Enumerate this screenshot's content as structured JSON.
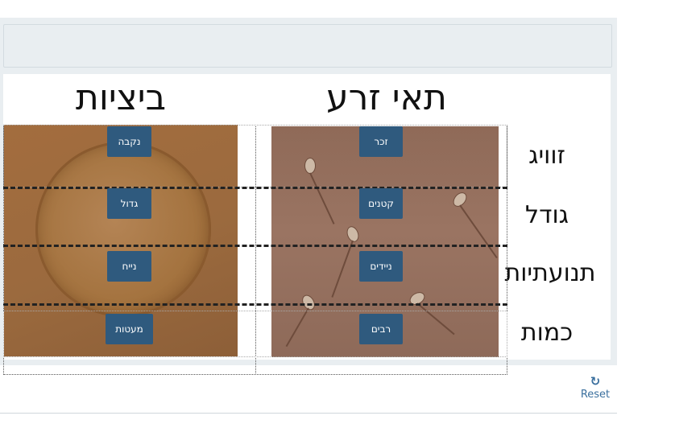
{
  "headings": {
    "eggs": "ביציות",
    "sperm": "תאי זרע"
  },
  "row_labels": [
    "זוויג",
    "גודל",
    "תנועתיות",
    "כמות"
  ],
  "tags": {
    "sperm": [
      "זכר",
      "קטנים",
      "ניידים",
      "רבים"
    ],
    "eggs": [
      "נקבה",
      "גדול",
      "נייח",
      "מעטות"
    ]
  },
  "reset": {
    "icon": "refresh-icon",
    "label": "Reset"
  },
  "colors": {
    "tag_bg": "#2f5a7e",
    "frame_bg": "#e9eef1",
    "link": "#3a6f9e"
  }
}
